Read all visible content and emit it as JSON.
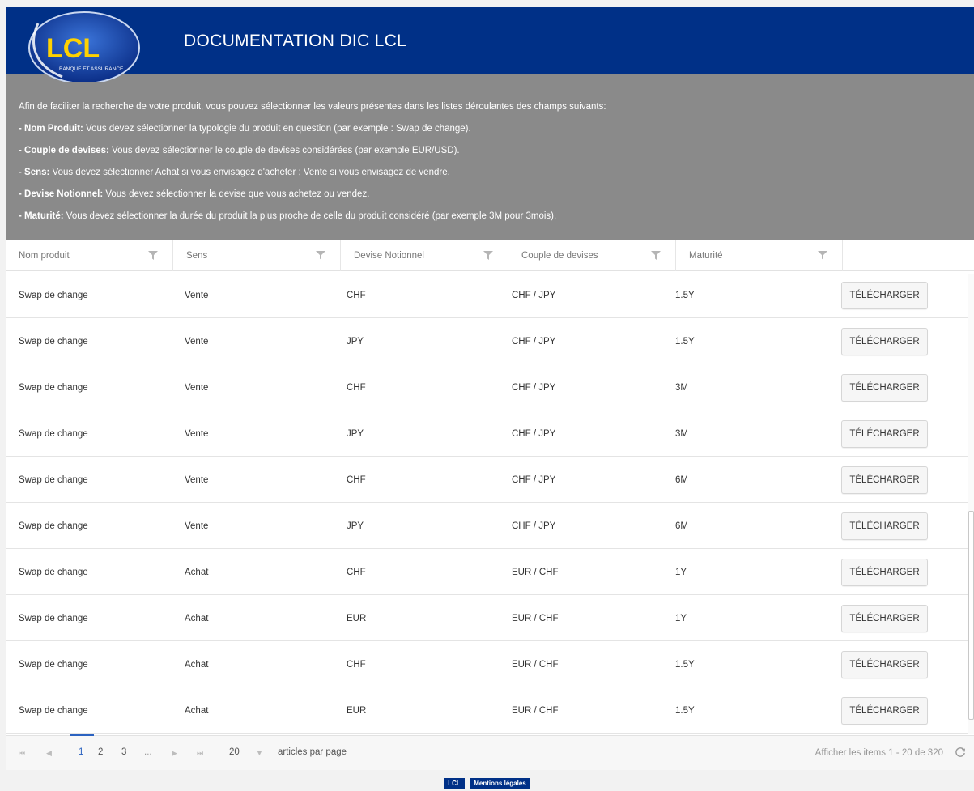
{
  "header": {
    "logo_text": "LCL",
    "logo_subtext": "BANQUE ET ASSURANCE",
    "title": "DOCUMENTATION DIC LCL"
  },
  "intro": {
    "text": "Afin de faciliter la recherche de votre produit, vous pouvez sélectionner les valeurs présentes dans les listes déroulantes des champs suivants:",
    "items": [
      {
        "label": "- Nom Produit:",
        "text": " Vous devez sélectionner la typologie du produit en question (par exemple : Swap de change)."
      },
      {
        "label": "- Couple de devises:",
        "text": " Vous devez sélectionner le couple de devises considérées (par exemple EUR/USD)."
      },
      {
        "label": "- Sens:",
        "text": " Vous devez sélectionner Achat si vous envisagez d'acheter ; Vente si vous envisagez de vendre."
      },
      {
        "label": "- Devise Notionnel:",
        "text": " Vous devez sélectionner la devise que vous achetez ou vendez."
      },
      {
        "label": "- Maturité:",
        "text": " Vous devez sélectionner la durée du produit la plus proche de celle du produit considéré (par exemple 3M pour 3mois)."
      }
    ]
  },
  "grid": {
    "columns": [
      "Nom produit",
      "Sens",
      "Devise Notionnel",
      "Couple de devises",
      "Maturité"
    ],
    "download_label": "TÉLÉCHARGER",
    "rows": [
      [
        "Swap de change",
        "Vente",
        "CHF",
        "CHF / JPY",
        "1.5Y"
      ],
      [
        "Swap de change",
        "Vente",
        "JPY",
        "CHF / JPY",
        "1.5Y"
      ],
      [
        "Swap de change",
        "Vente",
        "CHF",
        "CHF / JPY",
        "3M"
      ],
      [
        "Swap de change",
        "Vente",
        "JPY",
        "CHF / JPY",
        "3M"
      ],
      [
        "Swap de change",
        "Vente",
        "CHF",
        "CHF / JPY",
        "6M"
      ],
      [
        "Swap de change",
        "Vente",
        "JPY",
        "CHF / JPY",
        "6M"
      ],
      [
        "Swap de change",
        "Achat",
        "CHF",
        "EUR / CHF",
        "1Y"
      ],
      [
        "Swap de change",
        "Achat",
        "EUR",
        "EUR / CHF",
        "1Y"
      ],
      [
        "Swap de change",
        "Achat",
        "CHF",
        "EUR / CHF",
        "1.5Y"
      ],
      [
        "Swap de change",
        "Achat",
        "EUR",
        "EUR / CHF",
        "1.5Y"
      ]
    ]
  },
  "pager": {
    "pages": [
      "1",
      "2",
      "3",
      "..."
    ],
    "current_page": "1",
    "page_size": "20",
    "page_size_label": "articles par page",
    "info": "Afficher les items 1 - 20 de 320"
  },
  "footer": {
    "links": [
      "LCL",
      "Mentions légales"
    ]
  },
  "colors": {
    "header_bg": "#003087",
    "info_bg": "#8a8a8a",
    "accent": "#2b62c0"
  }
}
